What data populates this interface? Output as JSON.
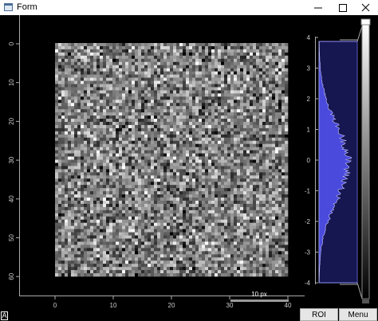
{
  "window": {
    "title": "Form",
    "icon": "qt-form-icon",
    "controls": [
      "minimize-icon",
      "maximize-icon",
      "close-icon"
    ]
  },
  "image_view": {
    "y_ticks": [
      "0",
      "10",
      "20",
      "30",
      "40",
      "50",
      "60"
    ],
    "x_ticks": [
      "0",
      "10",
      "20",
      "30",
      "40"
    ],
    "scale_bar_label": "10 px",
    "colormap": "grayscale",
    "image_content": "random noise"
  },
  "histogram": {
    "ticks": [
      "4",
      "3",
      "2",
      "1",
      "0",
      "-1",
      "-2",
      "-3",
      "-4"
    ],
    "fill_color": "#4a4adc",
    "region_color": "#1a1a5a"
  },
  "buttons": {
    "roi": "ROI",
    "menu": "Menu"
  },
  "corner_marker": "A"
}
